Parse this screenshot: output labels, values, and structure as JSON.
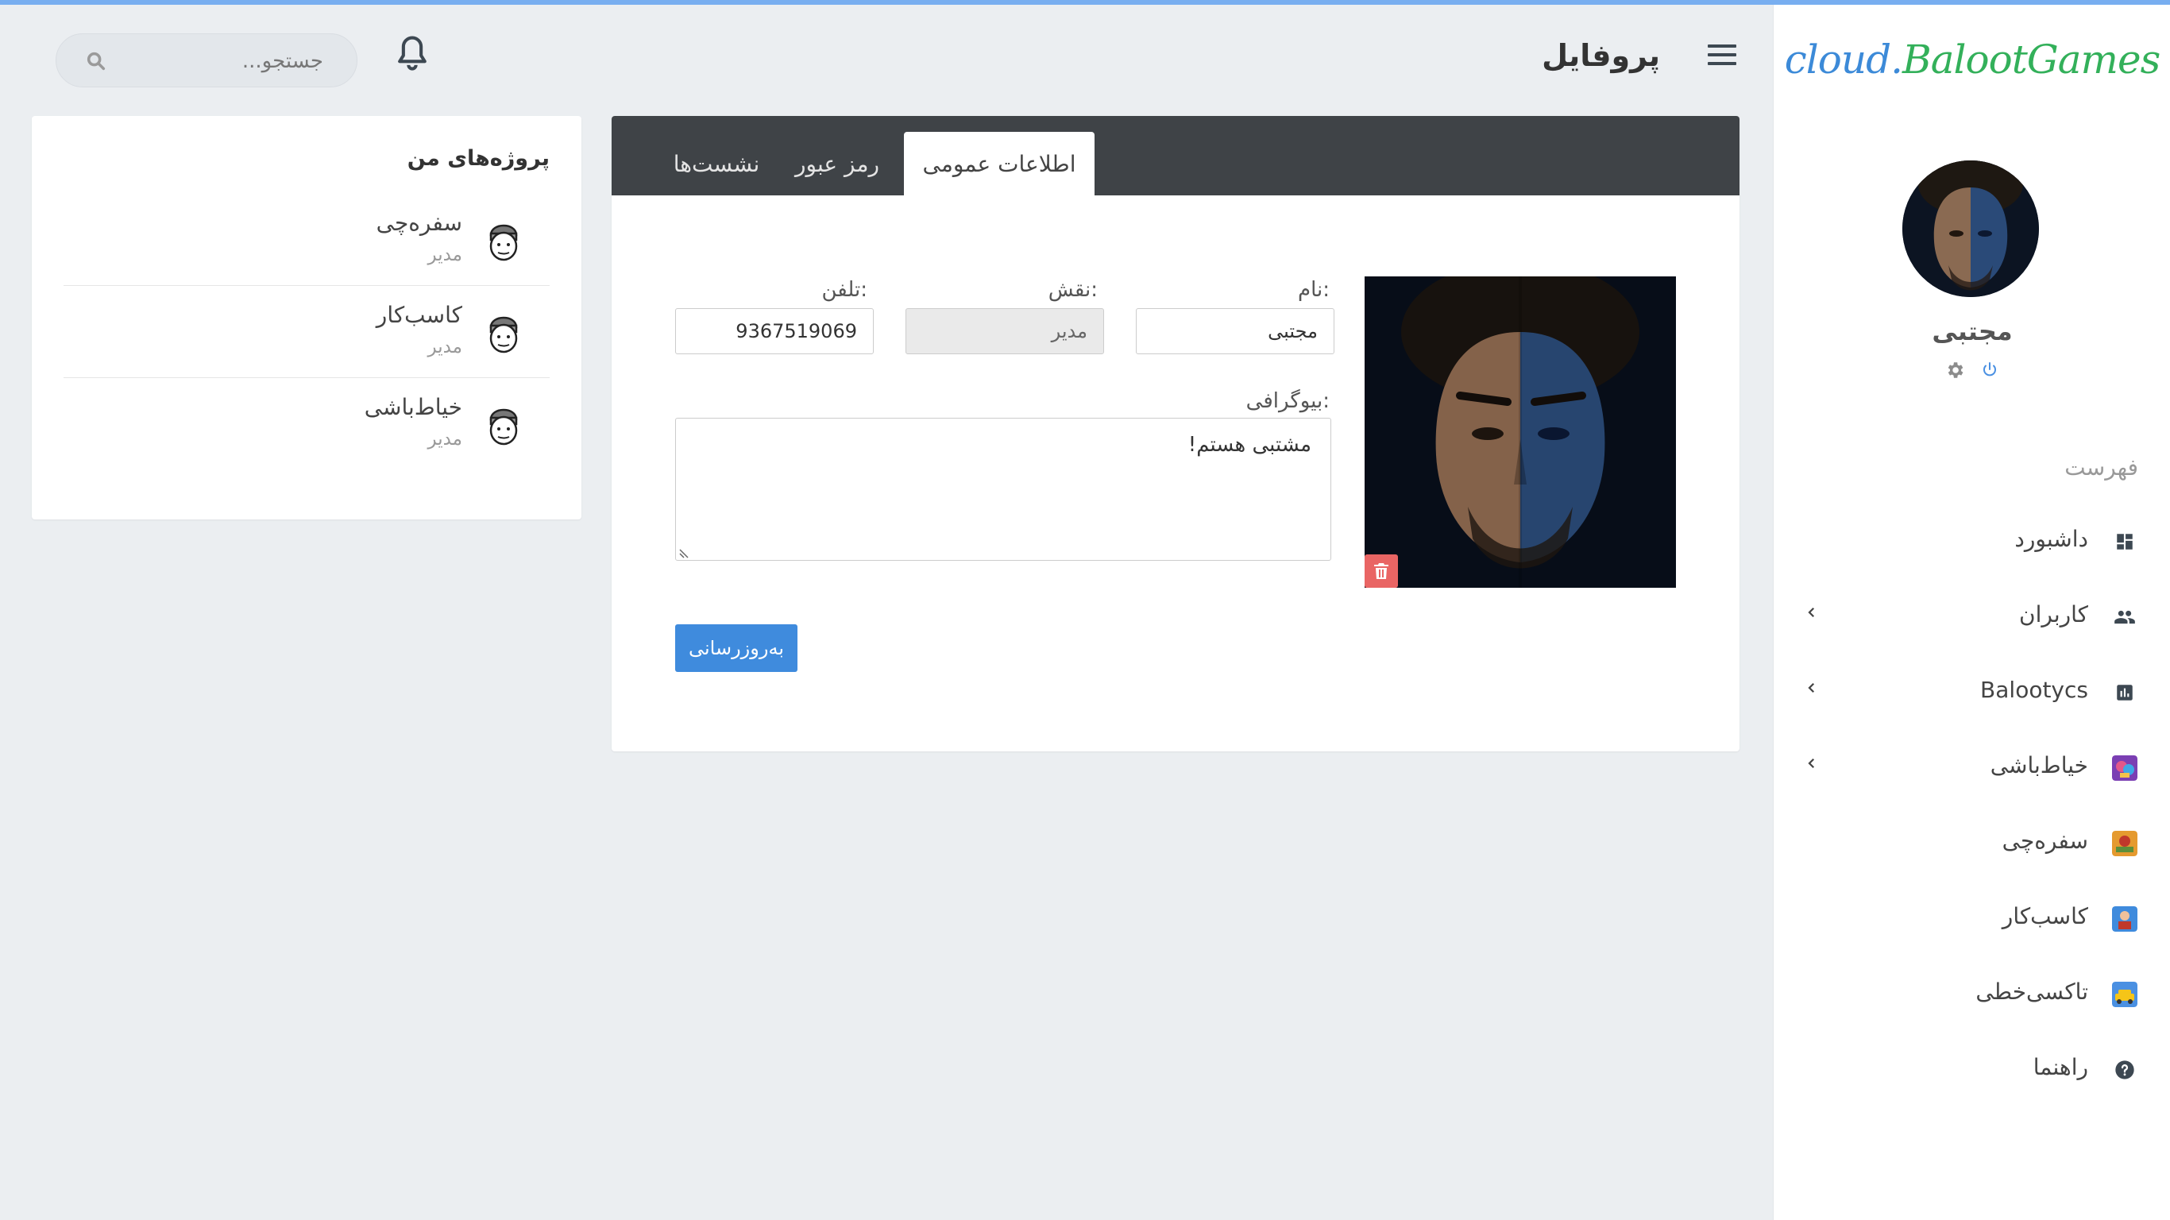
{
  "brand": {
    "logo_part1": "cloud.",
    "logo_part2": "BalootGames"
  },
  "user": {
    "name": "مجتبی"
  },
  "sidebar": {
    "menu_heading": "فهرست",
    "items": [
      {
        "label": "داشبورد",
        "icon": "dashboard-icon",
        "has_submenu": false
      },
      {
        "label": "کاربران",
        "icon": "users-icon",
        "has_submenu": true
      },
      {
        "label": "Balootycs",
        "icon": "chart-icon",
        "has_submenu": true
      },
      {
        "label": "خیاط‌باشی",
        "icon": "game-khayatbashi-icon",
        "has_submenu": true
      },
      {
        "label": "سفره‌چی",
        "icon": "game-sofrechi-icon",
        "has_submenu": false
      },
      {
        "label": "کاسب‌کار",
        "icon": "game-kasebkar-icon",
        "has_submenu": false
      },
      {
        "label": "تاکسی‌خطی",
        "icon": "game-taxi-icon",
        "has_submenu": false
      },
      {
        "label": "راهنما",
        "icon": "help-icon",
        "has_submenu": false
      }
    ]
  },
  "header": {
    "title": "پروفایل",
    "search_placeholder": "جستجو..."
  },
  "profile": {
    "tabs": [
      {
        "label": "اطلاعات عمومی",
        "active": true
      },
      {
        "label": "رمز عبور",
        "active": false
      },
      {
        "label": "نشست‌ها",
        "active": false
      }
    ],
    "fields": {
      "name_label": "نام:",
      "name_value": "مجتبی",
      "role_label": "نقش:",
      "role_value": "مدیر",
      "phone_label": "تلفن:",
      "phone_value": "9367519069",
      "bio_label": "بیوگرافی:",
      "bio_value": "مشتبی هستم!"
    },
    "update_button": "به‌روزرسانی"
  },
  "projects": {
    "title": "پروژه‌های من",
    "items": [
      {
        "name": "سفره‌چی",
        "role": "مدیر"
      },
      {
        "name": "کاسب‌کار",
        "role": "مدیر"
      },
      {
        "name": "خیاط‌باشی",
        "role": "مدیر"
      }
    ]
  },
  "colors": {
    "accent": "#3f8bdd",
    "topline": "#78aef0",
    "tabs_bar": "#3f4347",
    "danger": "#e96564",
    "logo_blue": "#3c8ad8",
    "logo_green": "#33b05a"
  }
}
